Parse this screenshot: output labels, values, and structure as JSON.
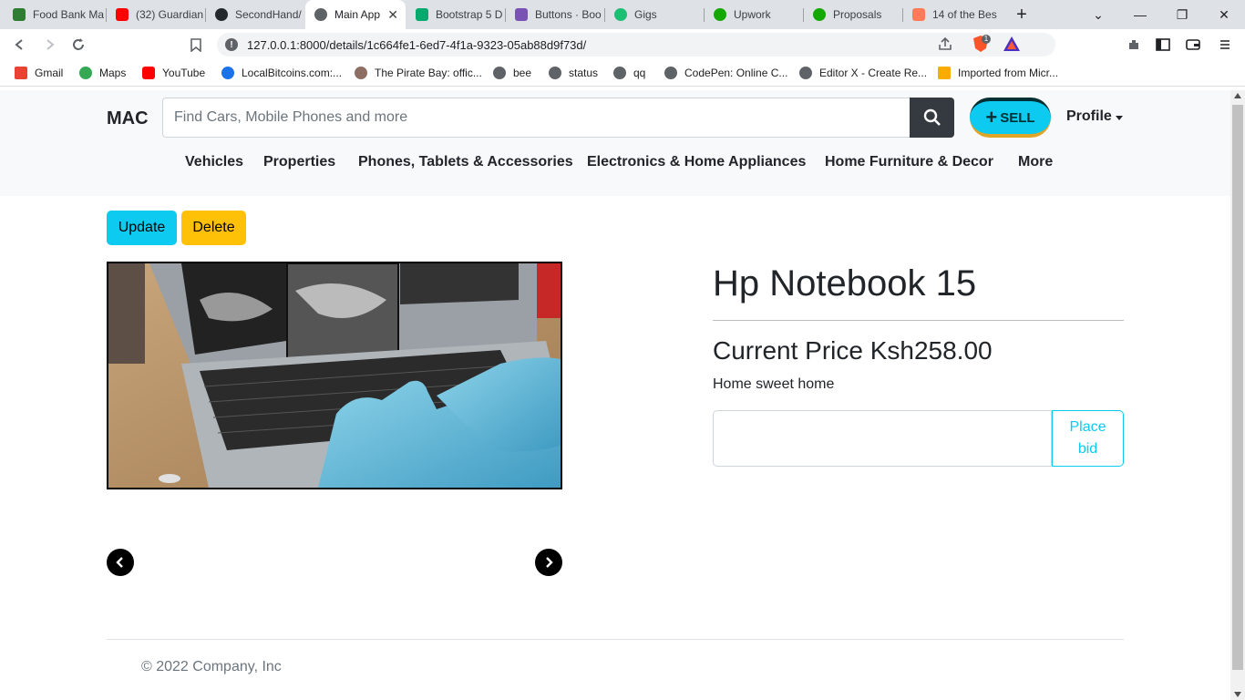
{
  "browser": {
    "tabs": [
      {
        "label": "Food Bank Ma",
        "icon": "leaf-icon",
        "color": "#2e7d32"
      },
      {
        "label": "(32) Guardian",
        "icon": "youtube-icon",
        "color": "#ff0000"
      },
      {
        "label": "SecondHand/",
        "icon": "github-icon",
        "color": "#24292e"
      },
      {
        "label": "Main App",
        "icon": "globe-icon",
        "color": "#5f6368"
      },
      {
        "label": "Bootstrap 5 D",
        "icon": "w3-icon",
        "color": "#04aa6d"
      },
      {
        "label": "Buttons · Boo",
        "icon": "bootstrap-icon",
        "color": "#7952b3"
      },
      {
        "label": "Gigs",
        "icon": "fiverr-icon",
        "color": "#1dbf73"
      },
      {
        "label": "Upwork",
        "icon": "upwork-icon",
        "color": "#14a800"
      },
      {
        "label": "Proposals",
        "icon": "upwork-icon",
        "color": "#14a800"
      },
      {
        "label": "14 of the Bes",
        "icon": "hubspot-icon",
        "color": "#ff7a59"
      }
    ],
    "url": "127.0.0.1:8000/details/1c664fe1-6ed7-4f1a-9323-05ab88d9f73d/",
    "brave_badge": "1",
    "bookmarks": [
      {
        "label": "Gmail",
        "icon": "gmail-icon",
        "color": "#ea4335"
      },
      {
        "label": "Maps",
        "icon": "maps-icon",
        "color": "#34a853"
      },
      {
        "label": "YouTube",
        "icon": "youtube-icon",
        "color": "#ff0000"
      },
      {
        "label": "LocalBitcoins.com:...",
        "icon": "bitcoin-icon",
        "color": "#1a73e8"
      },
      {
        "label": "The Pirate Bay: offic...",
        "icon": "pirate-icon",
        "color": "#8d6e63"
      },
      {
        "label": "bee",
        "icon": "globe-icon",
        "color": "#5f6368"
      },
      {
        "label": "status",
        "icon": "globe-icon",
        "color": "#5f6368"
      },
      {
        "label": "qq",
        "icon": "globe-icon",
        "color": "#5f6368"
      },
      {
        "label": "CodePen: Online C...",
        "icon": "globe-icon",
        "color": "#5f6368"
      },
      {
        "label": "Editor X - Create Re...",
        "icon": "globe-icon",
        "color": "#5f6368"
      },
      {
        "label": "Imported from Micr...",
        "icon": "folder-icon",
        "color": "#f9ab00"
      }
    ]
  },
  "navbar": {
    "brand": "MAC",
    "search_placeholder": "Find Cars, Mobile Phones and more",
    "sell_label": "SELL",
    "profile_label": "Profile",
    "categories": [
      "Vehicles",
      "Properties",
      "Phones, Tablets & Accessories",
      "Electronics & Home Appliances",
      "Home Furniture & Decor",
      "More"
    ]
  },
  "actions": {
    "update_label": "Update",
    "delete_label": "Delete"
  },
  "product": {
    "title": "Hp Notebook 15",
    "price_text": "Current Price Ksh258.00",
    "description": "Home sweet home",
    "bid_button": "Place bid"
  },
  "footer": {
    "copyright": "© 2022 Company, Inc"
  },
  "colors": {
    "info": "#0dcaf0",
    "warning": "#ffc107",
    "dark": "#343a40"
  }
}
